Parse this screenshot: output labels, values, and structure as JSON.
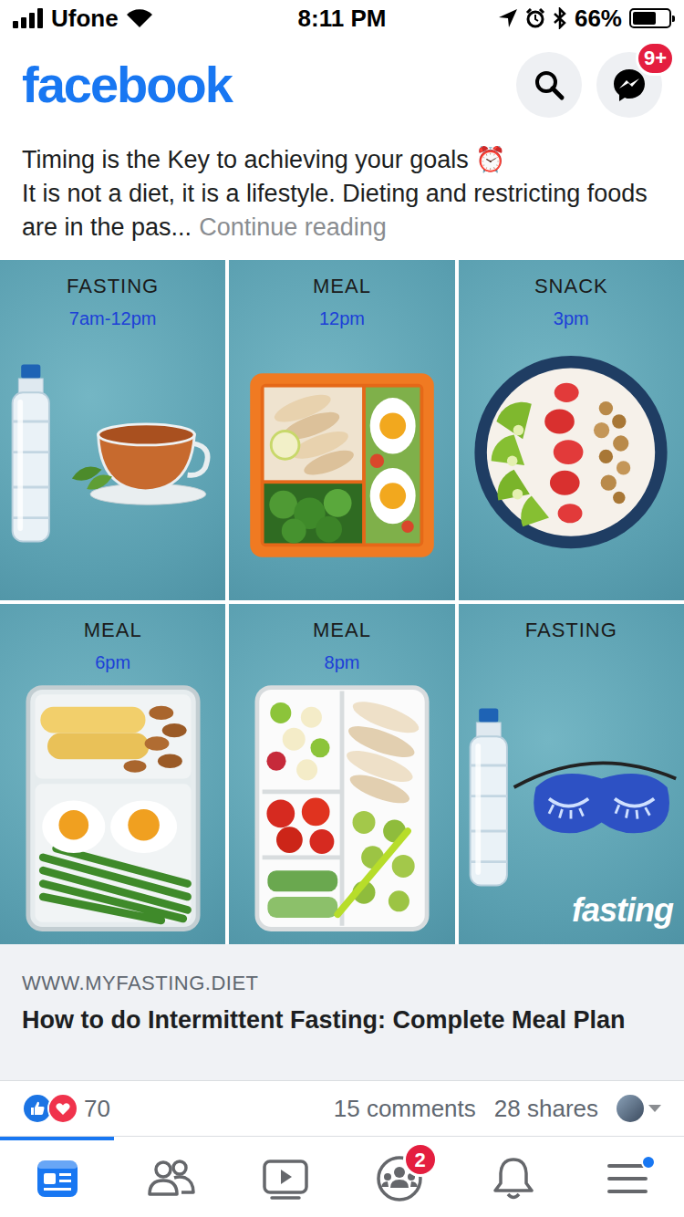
{
  "status_bar": {
    "carrier": "Ufone",
    "time": "8:11 PM",
    "battery": "66%",
    "battery_level": 0.66
  },
  "header": {
    "logo": "facebook",
    "messenger_badge": "9+"
  },
  "post": {
    "title": "Timing is the Key to achieving your goals ⏰",
    "body": "It is not a diet, it is a lifestyle. Dieting and restricting foods are in the pas...",
    "more": "Continue reading",
    "image": {
      "cells": [
        {
          "label": "FASTING",
          "time": "7am-12pm",
          "kind": "water-tea"
        },
        {
          "label": "MEAL",
          "time": "12pm",
          "kind": "lunch-box"
        },
        {
          "label": "SNACK",
          "time": "3pm",
          "kind": "bowl"
        },
        {
          "label": "MEAL",
          "time": "6pm",
          "kind": "glass-box"
        },
        {
          "label": "MEAL",
          "time": "8pm",
          "kind": "white-box"
        },
        {
          "label": "FASTING",
          "kind": "water-mask"
        }
      ],
      "watermark": "fasting"
    },
    "link": {
      "domain": "WWW.MYFASTING.DIET",
      "title": "How to do Intermittent Fasting: Complete Meal Plan"
    },
    "reactions": "70",
    "comments": "15 comments",
    "shares": "28 shares"
  },
  "tabs": [
    {
      "kind": "news-feed",
      "selected": true
    },
    {
      "kind": "friends",
      "selected": false
    },
    {
      "kind": "watch",
      "selected": false
    },
    {
      "kind": "groups",
      "selected": false,
      "badge": "2"
    },
    {
      "kind": "notifications",
      "selected": false
    },
    {
      "kind": "menu",
      "selected": false,
      "dot": true
    }
  ]
}
